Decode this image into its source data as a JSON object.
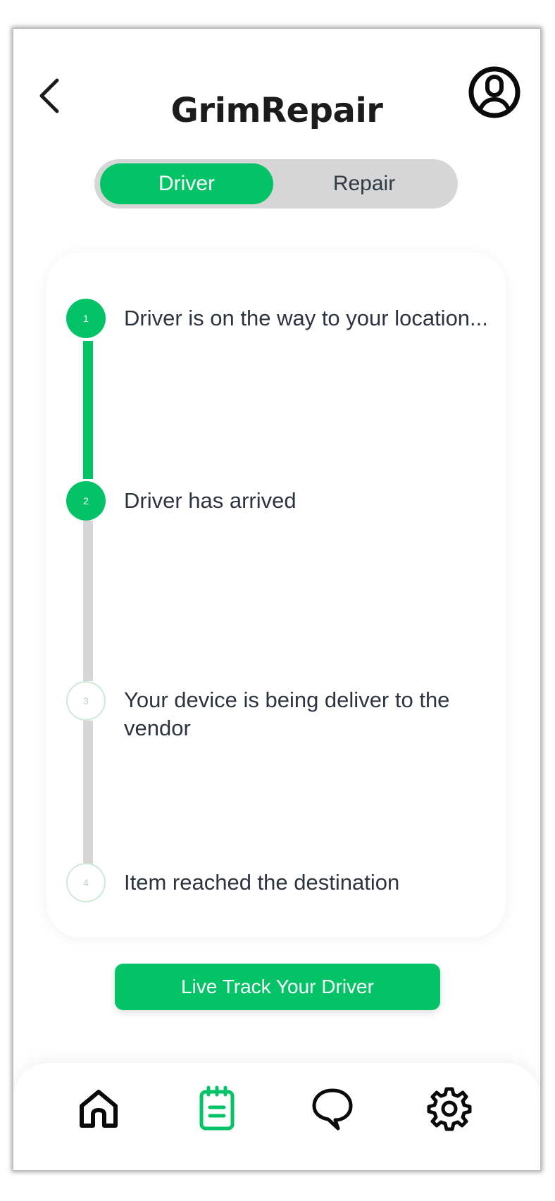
{
  "header": {
    "title": "GrimRepair"
  },
  "toggle": {
    "driver_label": "Driver",
    "repair_label": "Repair",
    "selected": "Driver"
  },
  "steps": [
    {
      "number": "1",
      "text": "Driver is on the way to your location...",
      "status": "done"
    },
    {
      "number": "2",
      "text": "Driver has arrived",
      "status": "done"
    },
    {
      "number": "3",
      "text": "Your device is being deliver to the vendor",
      "status": "pending"
    },
    {
      "number": "4",
      "text": "Item reached the destination",
      "status": "pending"
    }
  ],
  "actions": {
    "live_track_label": "Live Track Your Driver"
  },
  "bottom_nav": {
    "items": [
      "home-icon",
      "orders-icon",
      "chat-icon",
      "settings-icon"
    ],
    "active": "orders-icon"
  },
  "colors": {
    "accent": "#02c466",
    "track_inactive": "#d6d6d6",
    "text": "#2c3440"
  }
}
